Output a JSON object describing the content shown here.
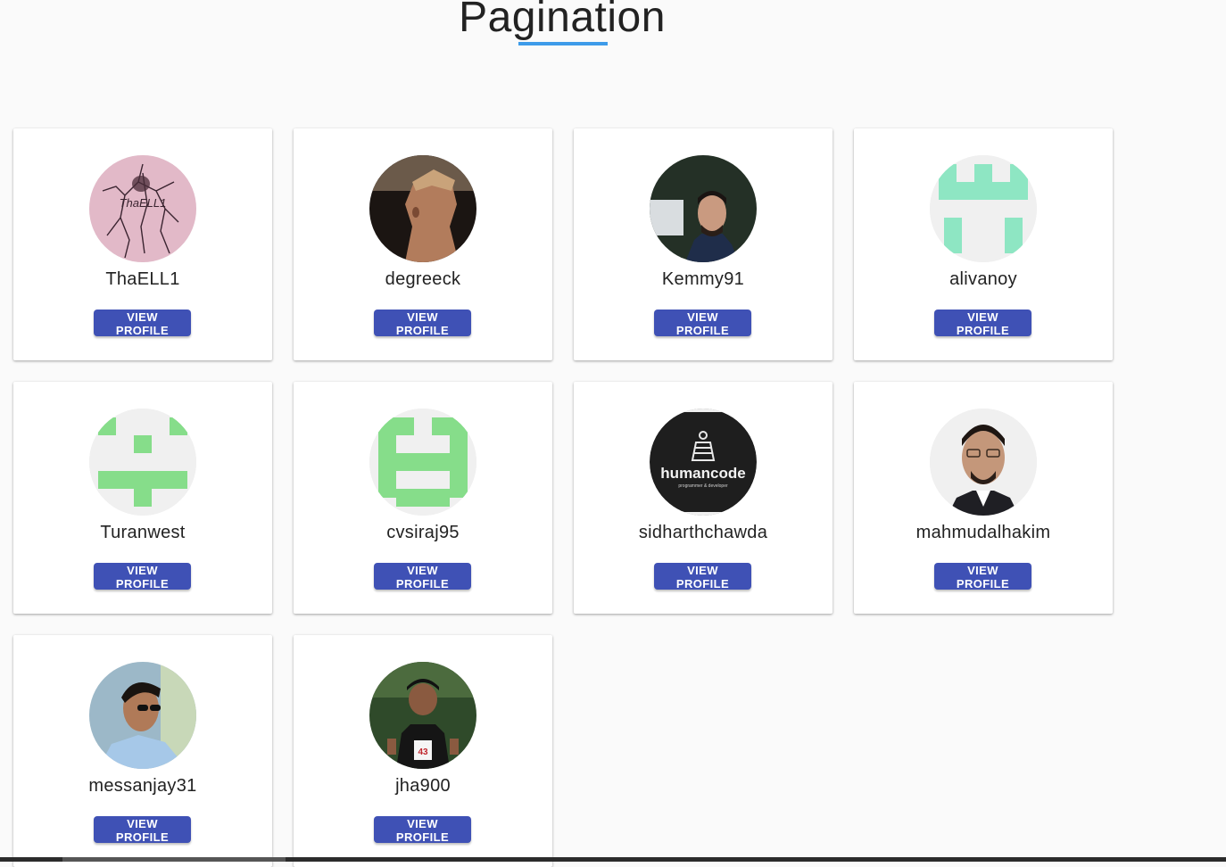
{
  "page": {
    "title": "Pagination",
    "accent_color": "#3d9be9",
    "button_color": "#3f51b5"
  },
  "users": [
    {
      "username": "ThaELL1",
      "button_label": "VIEW PROFILE",
      "avatar": "photo-avatar",
      "avatar_text": "ThaELL1"
    },
    {
      "username": "degreeck",
      "button_label": "VIEW PROFILE",
      "avatar": "photo-avatar"
    },
    {
      "username": "Kemmy91",
      "button_label": "VIEW PROFILE",
      "avatar": "photo-avatar"
    },
    {
      "username": "alivanoy",
      "button_label": "VIEW PROFILE",
      "avatar": "identicon-avatar"
    },
    {
      "username": "Turanwest",
      "button_label": "VIEW PROFILE",
      "avatar": "identicon-avatar"
    },
    {
      "username": "cvsiraj95",
      "button_label": "VIEW PROFILE",
      "avatar": "identicon-avatar"
    },
    {
      "username": "sidharthchawda",
      "button_label": "VIEW PROFILE",
      "avatar": "logo-avatar",
      "avatar_text": "humancode",
      "avatar_subtext": "programmer & developer"
    },
    {
      "username": "mahmudalhakim",
      "button_label": "VIEW PROFILE",
      "avatar": "photo-avatar"
    },
    {
      "username": "messanjay31",
      "button_label": "VIEW PROFILE",
      "avatar": "photo-avatar"
    },
    {
      "username": "jha900",
      "button_label": "VIEW PROFILE",
      "avatar": "photo-avatar",
      "avatar_text": "43"
    }
  ]
}
